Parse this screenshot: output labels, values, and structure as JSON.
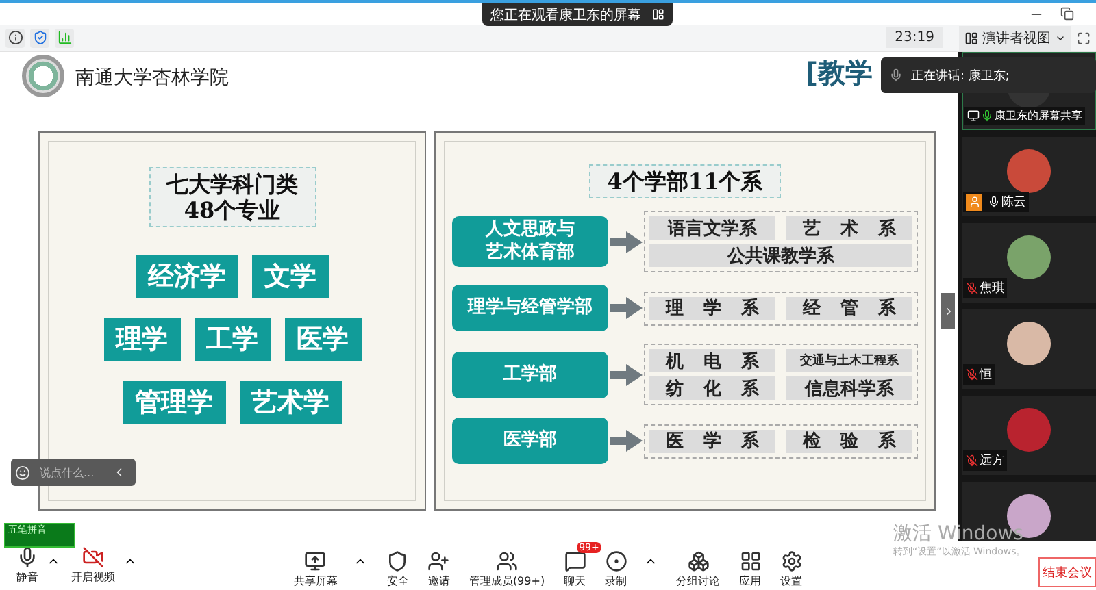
{
  "top_bar": {
    "tooltip": "您正在观看康卫东的屏幕"
  },
  "info_bar": {
    "time": "23:19",
    "view_button": "演讲者视图"
  },
  "slide": {
    "school_name": "南通大学杏林学院",
    "title": "[教学",
    "left_panel": {
      "heading_lines": [
        "七大学科门类",
        "48个专业"
      ],
      "rows": [
        [
          "经济学",
          "文学"
        ],
        [
          "理学",
          "工学",
          "医学"
        ],
        [
          "管理学",
          "艺术学"
        ]
      ]
    },
    "right_panel": {
      "heading": "4个学部11个系",
      "divisions": [
        {
          "name_lines": [
            "人文思政与",
            "艺术体育部"
          ],
          "departments": [
            {
              "label": "语言文学系",
              "kind": "normal"
            },
            {
              "label": "艺 术 系",
              "kind": "normal"
            },
            {
              "label": "公共课教学系",
              "kind": "wide"
            }
          ]
        },
        {
          "name_lines": [
            "理学与经管学部"
          ],
          "departments": [
            {
              "label": "理 学 系",
              "kind": "normal"
            },
            {
              "label": "经 管 系",
              "kind": "normal"
            }
          ]
        },
        {
          "name_lines": [
            "工学部"
          ],
          "departments": [
            {
              "label": "机 电 系",
              "kind": "normal"
            },
            {
              "label": "交通与土木工程系",
              "kind": "small"
            },
            {
              "label": "纺 化 系",
              "kind": "normal"
            },
            {
              "label": "信息科学系",
              "kind": "normal"
            }
          ]
        },
        {
          "name_lines": [
            "医学部"
          ],
          "departments": [
            {
              "label": "医 学 系",
              "kind": "normal"
            },
            {
              "label": "检 验 系",
              "kind": "normal"
            }
          ]
        }
      ]
    }
  },
  "speaking": {
    "label": "正在讲话: 康卫东;"
  },
  "participants": [
    {
      "name": "康卫东的屏幕共享",
      "kind": "screen_share",
      "muted": false,
      "speaking": true,
      "host": false
    },
    {
      "name": "陈云",
      "kind": "member",
      "muted": false,
      "speaking": false,
      "host": true
    },
    {
      "name": "焦琪",
      "kind": "member",
      "muted": true,
      "host": false
    },
    {
      "name": "恒",
      "kind": "member",
      "muted": true,
      "host": false
    },
    {
      "name": "远方",
      "kind": "member",
      "muted": true,
      "host": false
    },
    {
      "kind": "member",
      "host": false
    }
  ],
  "chat_input": {
    "placeholder": "说点什么..."
  },
  "ime": {
    "label": "五笔拼音"
  },
  "toolbar": {
    "left": [
      {
        "label": "静音",
        "kind": "mic",
        "caret": true
      },
      {
        "label": "开启视频",
        "kind": "video_off",
        "caret": true
      }
    ],
    "center": [
      {
        "label": "共享屏幕",
        "kind": "share",
        "caret": true
      },
      {
        "label": "安全",
        "kind": "security",
        "caret": false
      },
      {
        "label": "邀请",
        "kind": "invite",
        "caret": false
      },
      {
        "label": "管理成员(99+)",
        "kind": "members",
        "caret": false
      },
      {
        "label": "聊天",
        "kind": "chat",
        "caret": false,
        "badge": "99+"
      },
      {
        "label": "录制",
        "kind": "record",
        "caret": true
      },
      {
        "label": "分组讨论",
        "kind": "breakout",
        "caret": false
      },
      {
        "label": "应用",
        "kind": "apps",
        "caret": false
      },
      {
        "label": "设置",
        "kind": "settings",
        "caret": false
      }
    ],
    "end_button": "结束会议"
  },
  "os_notice": {
    "title": "激活 Windows",
    "hint": "转到“设置”以激活 Windows。"
  }
}
